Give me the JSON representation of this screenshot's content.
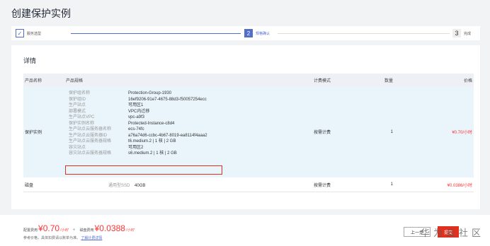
{
  "page": {
    "title": "创建保护实例"
  },
  "steps": [
    {
      "index": "✓",
      "label": "服务选型"
    },
    {
      "index": "2",
      "label": "规格确认"
    },
    {
      "index": "3",
      "label": "完成"
    }
  ],
  "detail": {
    "heading": "详情",
    "columns": {
      "name": "产品名称",
      "spec": "产品规格",
      "billing": "计费模式",
      "quantity": "数量",
      "price": "价格"
    },
    "rows": [
      {
        "name": "保护实例",
        "specs": [
          {
            "k": "保护组名称",
            "v": "Protection-Group-1930"
          },
          {
            "k": "保护组ID",
            "v": "16ef9206-91e7-4675-88d3-f50057254ecc"
          },
          {
            "k": "生产站点",
            "v": "可用区1"
          },
          {
            "k": "部署模式",
            "v": "VPC内迁移"
          },
          {
            "k": "生产站点VPC",
            "v": "vpc-a9f3"
          },
          {
            "k": "保护实例名称",
            "v": "Protected-Instance-c8d4"
          },
          {
            "k": "生产站点云服务器名称",
            "v": "ecs-74fc"
          },
          {
            "k": "生产站点云服务器ID",
            "v": "a76a74d6-ccbc-4b67-8019-ea8114f4aaa2"
          },
          {
            "k": "生产站点云服务器规格",
            "v": "t6.medium.2 | 1 核 | 2 GB"
          },
          {
            "k": "容灾站点",
            "v": "可用区2"
          },
          {
            "k": "容灾站点云服务器规格",
            "v": "s6.medium.2 | 1 核 | 2 GB"
          }
        ],
        "billing": "按需计费",
        "quantity": "1",
        "price": "¥0.70/小时"
      },
      {
        "name": "磁盘",
        "spec_type": "通用型SSD",
        "spec_size": "40GB",
        "billing": "按需计费",
        "quantity": "1",
        "price": "¥0.0386/小时"
      }
    ]
  },
  "footer": {
    "config_label": "配置费用",
    "config_price": "¥0.70",
    "config_unit": "/小时",
    "plus": "+",
    "disk_label": "磁盘费用",
    "disk_price": "¥0.0388",
    "disk_unit": "/小时",
    "note": "参考价格，具体扣费请以账单为准。",
    "note_link": "了解计费详情",
    "prev_button": "上一步",
    "submit_button": "提交",
    "watermark": "华为云社区"
  },
  "colors": {
    "accent": "#526ecc",
    "danger": "#e0301e",
    "price": "#ff3333"
  }
}
